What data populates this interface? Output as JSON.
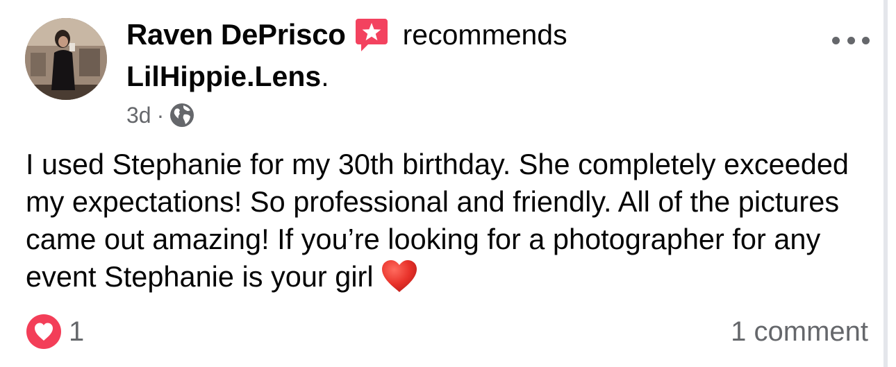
{
  "post": {
    "author": "Raven DePrisco",
    "action": "recommends",
    "page_name": "LilHippie.Lens",
    "page_suffix": ".",
    "time": "3d",
    "separator": "·",
    "audience_icon": "globe-icon",
    "badge_icon": "recommendation-star-icon",
    "more_icon": "more-horizontal-icon",
    "body": "I used Stephanie for my 30th birthday. She completely exceeded my expectations! So professional and friendly. All of the pictures came out amazing! If you’re looking for a photographer for any event Stephanie is your girl",
    "body_emoji": "red-heart-emoji"
  },
  "footer": {
    "reaction_icon": "love-reaction-icon",
    "reaction_count": "1",
    "comment_count": "1 comment"
  },
  "colors": {
    "badge": "#f3425f",
    "reaction": "#f33e58",
    "secondary_text": "#65676b",
    "primary_text": "#050505"
  }
}
